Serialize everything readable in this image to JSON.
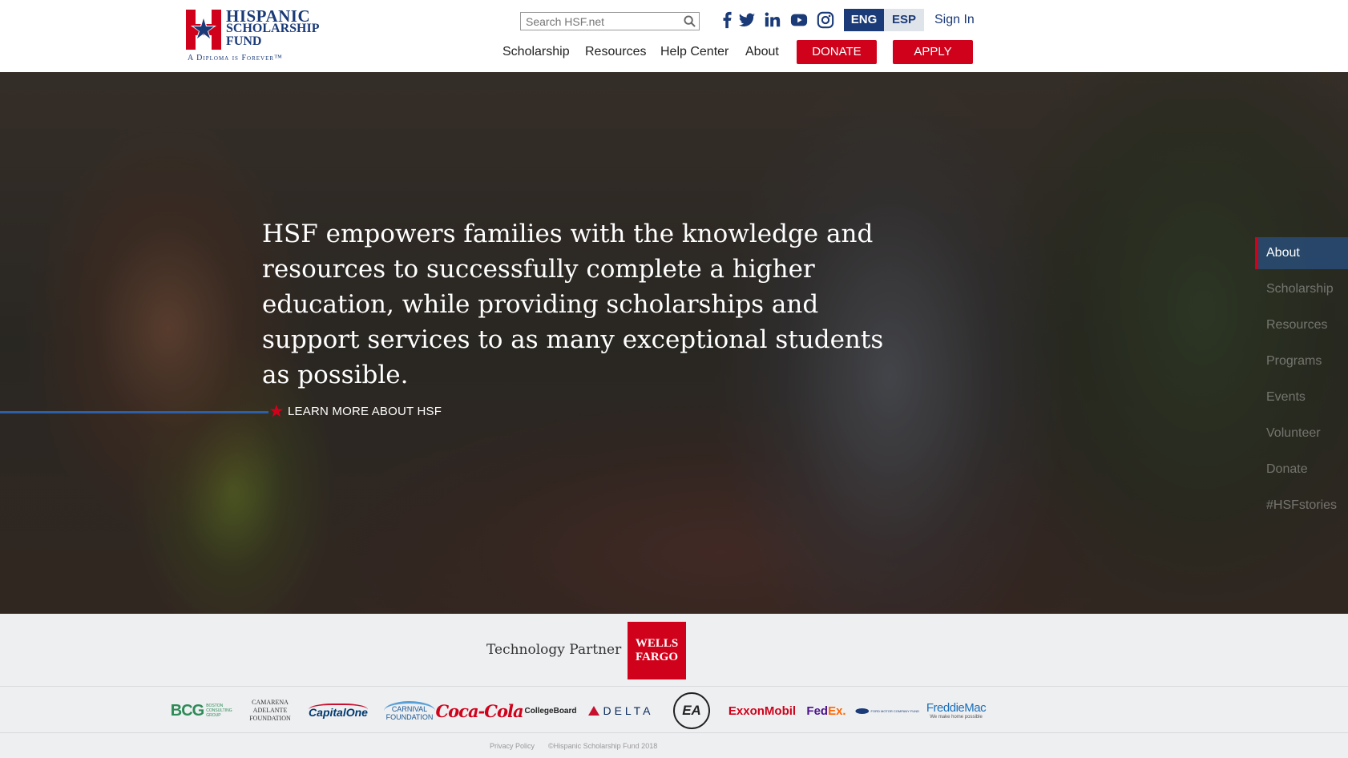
{
  "header": {
    "logo": {
      "line1": "HISPANIC",
      "line2": "SCHOLARSHIP",
      "line3": "FUND",
      "tagline": "A Diploma is Forever™"
    },
    "search": {
      "placeholder": "Search HSF.net",
      "value": ""
    },
    "social": [
      "facebook-icon",
      "twitter-icon",
      "linkedin-icon",
      "youtube-icon",
      "instagram-icon"
    ],
    "lang": {
      "eng": "ENG",
      "esp": "ESP",
      "selected": "ENG"
    },
    "sign_in": "Sign In",
    "nav": [
      "Scholarship",
      "Resources",
      "Help Center",
      "About"
    ],
    "donate": "DONATE",
    "apply": "APPLY"
  },
  "hero": {
    "statement": "HSF empowers families with the knowledge and resources to successfully complete a higher education, while providing scholarships and support services to as many exceptional students as possible.",
    "cta": "LEARN MORE ABOUT HSF"
  },
  "side_nav": {
    "items": [
      "About",
      "Scholarship",
      "Resources",
      "Programs",
      "Events",
      "Volunteer",
      "Donate",
      "#HSFstories"
    ],
    "active": "About"
  },
  "partners": {
    "tech_label": "Technology Partner",
    "tech_partner": {
      "line1": "WELLS",
      "line2": "FARGO"
    },
    "sponsors": {
      "bcg": "BCG",
      "bcg_sub": "BOSTON CONSULTING GROUP",
      "camarena": "CAMARENA ADELANTE FOUNDATION",
      "capital_one": "CapitalOne",
      "carnival": "CARNIVAL FOUNDATION",
      "coca_cola": "Coca-Cola",
      "college_board": "CollegeBoard",
      "delta": "DELTA",
      "ea": "EA",
      "exxon": "ExxonMobil",
      "fedex_fed": "Fed",
      "fedex_ex": "Ex.",
      "ford": "FORD MOTOR COMPANY FUND",
      "freddie": "FreddieMac",
      "freddie_sub": "We make home possible"
    }
  },
  "footer": {
    "privacy": "Privacy Policy",
    "copyright": "©Hispanic Scholarship Fund 2018"
  },
  "colors": {
    "brand_blue": "#1a3a78",
    "brand_red": "#d0021b"
  }
}
